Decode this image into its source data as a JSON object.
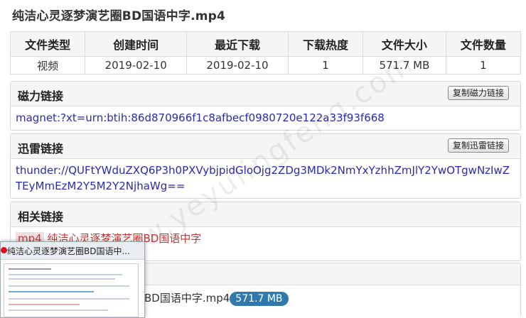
{
  "page_title": "纯洁心灵逐梦演艺圈BD国语中字.mp4",
  "info_table": {
    "headers": [
      "文件类型",
      "创建时间",
      "最近下载",
      "下载热度",
      "文件大小",
      "文件数量"
    ],
    "row": [
      "视频",
      "2019-02-10",
      "2019-02-10",
      "1",
      "571.7 MB",
      "1"
    ]
  },
  "magnet": {
    "title": "磁力链接",
    "copy_button": "复制磁力链接",
    "link": "magnet:?xt=urn:btih:86d870966f1c8afbecf0980720e122a33f93f668"
  },
  "thunder": {
    "title": "迅雷链接",
    "copy_button": "复制迅雷链接",
    "link": "thunder://QUFtYWduZXQ6P3h0PXVybjpidGloOjg2ZDg3MDk2NmYxYzhhZmJlY2YwOTgwNzIwZTEyMmEzM2Y5M2Y2NjhaWg=="
  },
  "related": {
    "title": "相关链接",
    "format": "mp4",
    "item_text": "纯洁心灵逐梦演艺圈BD国语中字"
  },
  "file_list": {
    "file_name_visible": "BD国语中字.mp4",
    "size_badge": "571.7 MB"
  },
  "thumbnail": {
    "title": "纯洁心灵逐梦演艺圈BD国语中..."
  },
  "watermark": "www.yeyulingfeng.com"
}
